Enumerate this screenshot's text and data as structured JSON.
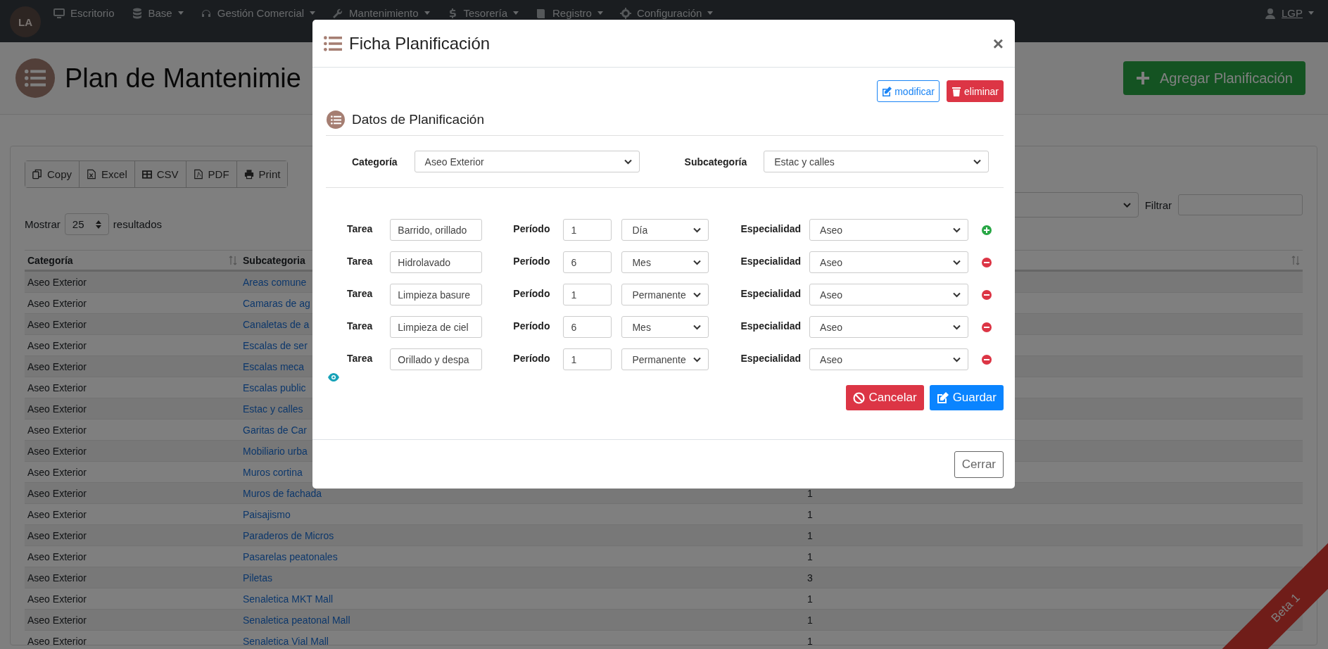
{
  "navbar": {
    "logo": "LA",
    "items": [
      {
        "label": "Escritorio",
        "dropdown": false
      },
      {
        "label": "Base",
        "dropdown": true
      },
      {
        "label": "Gestión Comercial",
        "dropdown": true
      },
      {
        "label": "Mantenimiento",
        "dropdown": true
      },
      {
        "label": "Tesorería",
        "dropdown": true
      },
      {
        "label": "Registro",
        "dropdown": true
      },
      {
        "label": "Configuración",
        "dropdown": true
      }
    ],
    "user": {
      "label": "LGP",
      "dropdown": true
    }
  },
  "page": {
    "title": "Plan de Mantenimie",
    "add_button": "Agregar Planificación"
  },
  "export_buttons": [
    "Copy",
    "Excel",
    "CSV",
    "PDF",
    "Print"
  ],
  "filter": {
    "label": "Filtrar"
  },
  "length": {
    "prefix": "Mostrar",
    "value": "25",
    "suffix": "resultados"
  },
  "table": {
    "columns": [
      {
        "label": "Categoría",
        "sortable": true
      },
      {
        "label": "Subcategoria"
      },
      {
        "sortable": true
      }
    ],
    "rows": [
      {
        "category": "Aseo Exterior",
        "subcategory": "Areas comune"
      },
      {
        "category": "Aseo Exterior",
        "subcategory": "Camaras de ag"
      },
      {
        "category": "Aseo Exterior",
        "subcategory": "Canaletas de a"
      },
      {
        "category": "Aseo Exterior",
        "subcategory": "Escalas de ser"
      },
      {
        "category": "Aseo Exterior",
        "subcategory": "Escalas meca"
      },
      {
        "category": "Aseo Exterior",
        "subcategory": "Escalas public"
      },
      {
        "category": "Aseo Exterior",
        "subcategory": "Estac y calles"
      },
      {
        "category": "Aseo Exterior",
        "subcategory": "Garitas de Car"
      },
      {
        "category": "Aseo Exterior",
        "subcategory": "Mobiliario urba"
      },
      {
        "category": "Aseo Exterior",
        "subcategory": "Muros cortina"
      },
      {
        "category": "Aseo Exterior",
        "subcategory": "Muros de fachada",
        "column_3": "1"
      },
      {
        "category": "Aseo Exterior",
        "subcategory": "Paisajismo",
        "column_3": "1"
      },
      {
        "category": "Aseo Exterior",
        "subcategory": "Paraderos de Micros",
        "column_3": "1"
      },
      {
        "category": "Aseo Exterior",
        "subcategory": "Pasarelas peatonales",
        "column_3": "1"
      },
      {
        "category": "Aseo Exterior",
        "subcategory": "Piletas",
        "column_3": "3"
      },
      {
        "category": "Aseo Exterior",
        "subcategory": "Senaletica MKT Mall",
        "column_3": "1"
      },
      {
        "category": "Aseo Exterior",
        "subcategory": "Senaletica peatonal Mall",
        "column_3": "1"
      },
      {
        "category": "Aseo Exterior",
        "subcategory": "Senaletica Vial Mall",
        "column_3": "1"
      }
    ]
  },
  "ribbon": "Beta 1",
  "modal": {
    "title": "Ficha Planificación",
    "close": "×",
    "actions": [
      {
        "label": "modificar",
        "kind": "edit"
      },
      {
        "label": "eliminar",
        "kind": "delete"
      }
    ],
    "section_title": "Datos de Planificación",
    "category": {
      "label": "Categoría",
      "value": "Aseo Exterior"
    },
    "subcategory": {
      "label": "Subcategoría",
      "value": "Estac y calles"
    },
    "tasks": [
      {
        "task_label": "Tarea",
        "task": "Barrido, orillado",
        "period_label": "Período",
        "period": "1",
        "unit": "Día",
        "specialty_label": "Especialidad",
        "specialty": "Aseo",
        "kind": "add"
      },
      {
        "task_label": "Tarea",
        "task": "Hidrolavado",
        "period_label": "Período",
        "period": "6",
        "unit": "Mes",
        "specialty_label": "Especialidad",
        "specialty": "Aseo",
        "kind": "remove"
      },
      {
        "task_label": "Tarea",
        "task": "Limpieza basure",
        "period_label": "Período",
        "period": "1",
        "unit": "Permanente",
        "specialty_label": "Especialidad",
        "specialty": "Aseo",
        "kind": "remove"
      },
      {
        "task_label": "Tarea",
        "task": "Limpieza de ciel",
        "period_label": "Período",
        "period": "6",
        "unit": "Mes",
        "specialty_label": "Especialidad",
        "specialty": "Aseo",
        "kind": "remove"
      },
      {
        "task_label": "Tarea",
        "task": "Orillado y despa",
        "period_label": "Período",
        "period": "1",
        "unit": "Permanente",
        "specialty_label": "Especialidad",
        "specialty": "Aseo",
        "kind": "remove"
      }
    ],
    "buttons": [
      {
        "label": "Cancelar",
        "kind": "cancel"
      },
      {
        "label": "Guardar",
        "kind": "save"
      }
    ],
    "footer_button": "Cerrar"
  }
}
